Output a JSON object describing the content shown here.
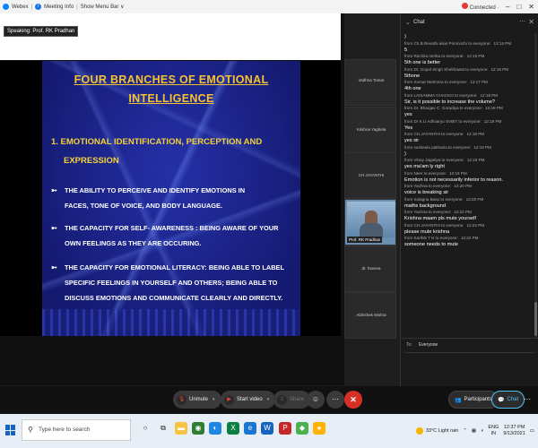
{
  "titlebar": {
    "app_name": "Webex",
    "meeting_info": "Meeting Info",
    "show_menu": "Show Menu Bar ∨",
    "connection": "Connected ∙",
    "win_min": "–",
    "win_max": "□",
    "win_close": "✕"
  },
  "stage": {
    "speaking": "Speaking: Prof. RK Pradhan",
    "slide": {
      "title_line1": "FOUR BRANCHES OF EMOTIONAL",
      "title_line2": "INTELLIGENCE",
      "heading_line1": "1.  EMOTIONAL IDENTIFICATION, PERCEPTION AND",
      "heading_line2": "EXPRESSION",
      "bullets": [
        {
          "line1": "THE ABILITY TO PERCEIVE AND IDENTIFY EMOTIONS IN",
          "line2": "FACES, TONE OF VOICE, AND BODY LANGUAGE.",
          "line3": ""
        },
        {
          "line1": "THE CAPACITY FOR SELF- AWARENESS : BEING AWARE OF YOUR",
          "line2": "OWN FEELINGS AS THEY ARE OCCURING.",
          "line3": ""
        },
        {
          "line1": "THE CAPACITY FOR EMOTIONAL LITERACY: BEING ABLE TO LABEL",
          "line2": "SPECIFIC FEELINGS IN YOURSELF AND OTHERS; BEING ABLE TO",
          "line3": "DISCUSS EMOTIONS AND COMMUNICATE CLEARLY AND DIRECTLY."
        }
      ]
    }
  },
  "participants": [
    {
      "name": "Vadhna\nTomar",
      "video": false
    },
    {
      "name": "Krishna Yaghela",
      "video": false
    },
    {
      "name": "CH JAYANTHI",
      "video": false
    },
    {
      "name": "Prof. RK Pradhan",
      "video": true
    },
    {
      "name": "dr. hseena",
      "video": false
    },
    {
      "name": "Abhishek Mishra",
      "video": false
    }
  ],
  "chat": {
    "title": "Chat",
    "to_label": "To:",
    "to_value": "Everyone",
    "messages": [
      {
        "meta": "",
        "time": "",
        "text": ")"
      },
      {
        "meta": "from Ch.B.Revathi alias Ponmozhi to everyone:",
        "time": "12:15 PM",
        "text": "5"
      },
      {
        "meta": "from Rachita mehta to everyone:",
        "time": "12:15 PM",
        "text": "5th one is better"
      },
      {
        "meta": "from Dr. Gopal Singh Shekhawat to everyone:",
        "time": "12:16 PM",
        "text": "5thone"
      },
      {
        "meta": "from Kumar Mehrotra to everyone:",
        "time": "12:17 PM",
        "text": "4th one"
      },
      {
        "meta": "from LAISAMMA CHACKO to everyone:",
        "time": "12:18 PM",
        "text": "Sir, is it possible to  increase the volume?"
      },
      {
        "meta": "from Dr. Bhargav C. Goradiya to everyone:",
        "time": "12:18 PM",
        "text": "yes"
      },
      {
        "meta": "from Dr K U Adhvaryu SVBIT to everyone:",
        "time": "12:18 PM",
        "text": "Yes"
      },
      {
        "meta": "from CH JAYANTHI to everyone:",
        "time": "12:18 PM",
        "text": "yes sir"
      },
      {
        "meta": "from susheela pathania to everyone:",
        "time": "12:19 PM",
        "text": ")"
      },
      {
        "meta": "from Vinay Jagatiya to everyone:",
        "time": "12:19 PM",
        "text": "yes ma'am ly right"
      },
      {
        "meta": "from Neer to everyone:",
        "time": "12:19 PM",
        "text": "Emotion is not necessarily inferior to reason."
      },
      {
        "meta": "from Yachna to everyone:",
        "time": "12:20 PM",
        "text": "voice  is breaking sir"
      },
      {
        "meta": "from Sulagna  Basu to everyone:",
        "time": "12:20 PM",
        "text": "maths background"
      },
      {
        "meta": "from Yachna to everyone:",
        "time": "12:22 PM",
        "text": "Krishna maam pls mute yourself"
      },
      {
        "meta": "from CH JAYANTHI to everyone:",
        "time": "12:22 PM",
        "text": "please mute krishna"
      },
      {
        "meta": "from Karthik T N  to everyone:",
        "time": "12:22 PM",
        "text": "someone needs to  mute"
      }
    ]
  },
  "controls": {
    "unmute": "Unmute",
    "start_video": "Start video",
    "share": "Share",
    "participants": "Participants",
    "chat": "Chat"
  },
  "taskbar": {
    "search_placeholder": "Type here to search",
    "weather": "33°C  Light rain",
    "lang1": "ENG",
    "lang2": "IN",
    "time": "12:37 PM",
    "date": "9/13/2021"
  }
}
